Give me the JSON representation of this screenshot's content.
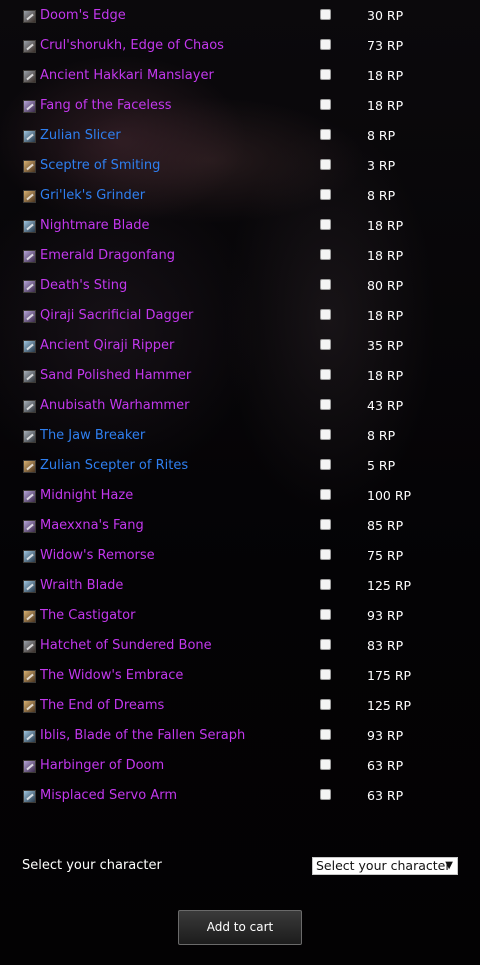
{
  "items": [
    {
      "name": "Doom's Edge",
      "price": "30 RP",
      "quality": "epic",
      "icon": "axe-icon"
    },
    {
      "name": "Crul'shorukh, Edge of Chaos",
      "price": "73 RP",
      "quality": "epic",
      "icon": "axe-icon"
    },
    {
      "name": "Ancient Hakkari Manslayer",
      "price": "18 RP",
      "quality": "epic",
      "icon": "axe-icon"
    },
    {
      "name": "Fang of the Faceless",
      "price": "18 RP",
      "quality": "epic",
      "icon": "dagger-icon"
    },
    {
      "name": "Zulian Slicer",
      "price": "8 RP",
      "quality": "rare",
      "icon": "sword-icon"
    },
    {
      "name": "Sceptre of Smiting",
      "price": "3 RP",
      "quality": "rare",
      "icon": "mace-icon"
    },
    {
      "name": "Gri'lek's Grinder",
      "price": "8 RP",
      "quality": "rare",
      "icon": "mace-icon"
    },
    {
      "name": "Nightmare Blade",
      "price": "18 RP",
      "quality": "epic",
      "icon": "sword-icon"
    },
    {
      "name": "Emerald Dragonfang",
      "price": "18 RP",
      "quality": "epic",
      "icon": "dagger-icon"
    },
    {
      "name": "Death's Sting",
      "price": "80 RP",
      "quality": "epic",
      "icon": "dagger-icon"
    },
    {
      "name": "Qiraji Sacrificial Dagger",
      "price": "18 RP",
      "quality": "epic",
      "icon": "dagger-icon"
    },
    {
      "name": "Ancient Qiraji Ripper",
      "price": "35 RP",
      "quality": "epic",
      "icon": "sword-icon"
    },
    {
      "name": "Sand Polished Hammer",
      "price": "18 RP",
      "quality": "epic",
      "icon": "hammer-icon"
    },
    {
      "name": "Anubisath Warhammer",
      "price": "43 RP",
      "quality": "epic",
      "icon": "hammer-icon"
    },
    {
      "name": "The Jaw Breaker",
      "price": "8 RP",
      "quality": "rare",
      "icon": "hammer-icon"
    },
    {
      "name": "Zulian Scepter of Rites",
      "price": "5 RP",
      "quality": "rare",
      "icon": "mace-icon"
    },
    {
      "name": "Midnight Haze",
      "price": "100 RP",
      "quality": "epic",
      "icon": "dagger-icon"
    },
    {
      "name": "Maexxna's Fang",
      "price": "85 RP",
      "quality": "epic",
      "icon": "dagger-icon"
    },
    {
      "name": "Widow's Remorse",
      "price": "75 RP",
      "quality": "epic",
      "icon": "sword-icon"
    },
    {
      "name": "Wraith Blade",
      "price": "125 RP",
      "quality": "epic",
      "icon": "sword-icon"
    },
    {
      "name": "The Castigator",
      "price": "93 RP",
      "quality": "epic",
      "icon": "mace-icon"
    },
    {
      "name": "Hatchet of Sundered Bone",
      "price": "83 RP",
      "quality": "epic",
      "icon": "axe-icon"
    },
    {
      "name": "The Widow's Embrace",
      "price": "175 RP",
      "quality": "epic",
      "icon": "mace-icon"
    },
    {
      "name": "The End of Dreams",
      "price": "125 RP",
      "quality": "epic",
      "icon": "mace-icon"
    },
    {
      "name": "Iblis, Blade of the Fallen Seraph",
      "price": "93 RP",
      "quality": "epic",
      "icon": "sword-icon"
    },
    {
      "name": "Harbinger of Doom",
      "price": "63 RP",
      "quality": "epic",
      "icon": "dagger-icon"
    },
    {
      "name": "Misplaced Servo Arm",
      "price": "63 RP",
      "quality": "epic",
      "icon": "sword-icon"
    }
  ],
  "character": {
    "label": "Select your character",
    "select_value": "Select your character"
  },
  "cart_button_label": "Add to cart",
  "colors": {
    "epic": "#c338ee",
    "rare": "#2f7ff0",
    "price": "#ffffff",
    "background": "#050406"
  }
}
